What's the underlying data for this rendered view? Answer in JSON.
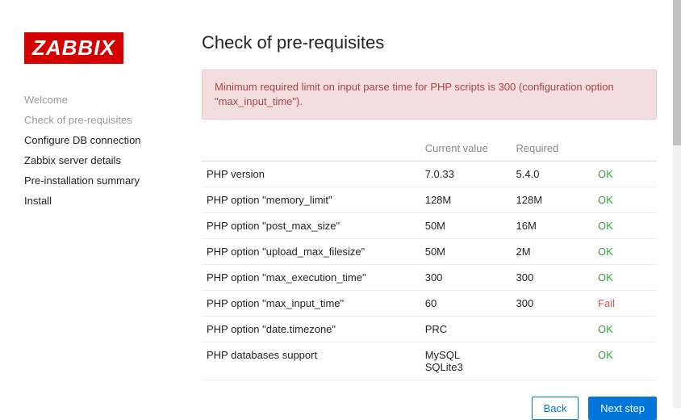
{
  "logo": "ZABBIX",
  "sidebar": {
    "items": [
      {
        "label": "Welcome",
        "muted": true
      },
      {
        "label": "Check of pre-requisites",
        "muted": true
      },
      {
        "label": "Configure DB connection",
        "muted": false
      },
      {
        "label": "Zabbix server details",
        "muted": false
      },
      {
        "label": "Pre-installation summary",
        "muted": false
      },
      {
        "label": "Install",
        "muted": false
      }
    ]
  },
  "page_title": "Check of pre-requisites",
  "alert": "Minimum required limit on input parse time for PHP scripts is 300 (configuration option \"max_input_time\").",
  "table": {
    "headers": {
      "name": "",
      "current": "Current value",
      "required": "Required",
      "status": ""
    },
    "rows": [
      {
        "name": "PHP version",
        "current": "7.0.33",
        "required": "5.4.0",
        "status": "OK",
        "status_class": "ok"
      },
      {
        "name": "PHP option \"memory_limit\"",
        "current": "128M",
        "required": "128M",
        "status": "OK",
        "status_class": "ok"
      },
      {
        "name": "PHP option \"post_max_size\"",
        "current": "50M",
        "required": "16M",
        "status": "OK",
        "status_class": "ok"
      },
      {
        "name": "PHP option \"upload_max_filesize\"",
        "current": "50M",
        "required": "2M",
        "status": "OK",
        "status_class": "ok"
      },
      {
        "name": "PHP option \"max_execution_time\"",
        "current": "300",
        "required": "300",
        "status": "OK",
        "status_class": "ok"
      },
      {
        "name": "PHP option \"max_input_time\"",
        "current": "60",
        "required": "300",
        "status": "Fail",
        "status_class": "fail"
      },
      {
        "name": "PHP option \"date.timezone\"",
        "current": "PRC",
        "required": "",
        "status": "OK",
        "status_class": "ok"
      },
      {
        "name": "PHP databases support",
        "current": "MySQL\nSQLite3",
        "required": "",
        "status": "OK",
        "status_class": "ok",
        "section_break": true
      }
    ]
  },
  "buttons": {
    "back": "Back",
    "next": "Next step"
  }
}
